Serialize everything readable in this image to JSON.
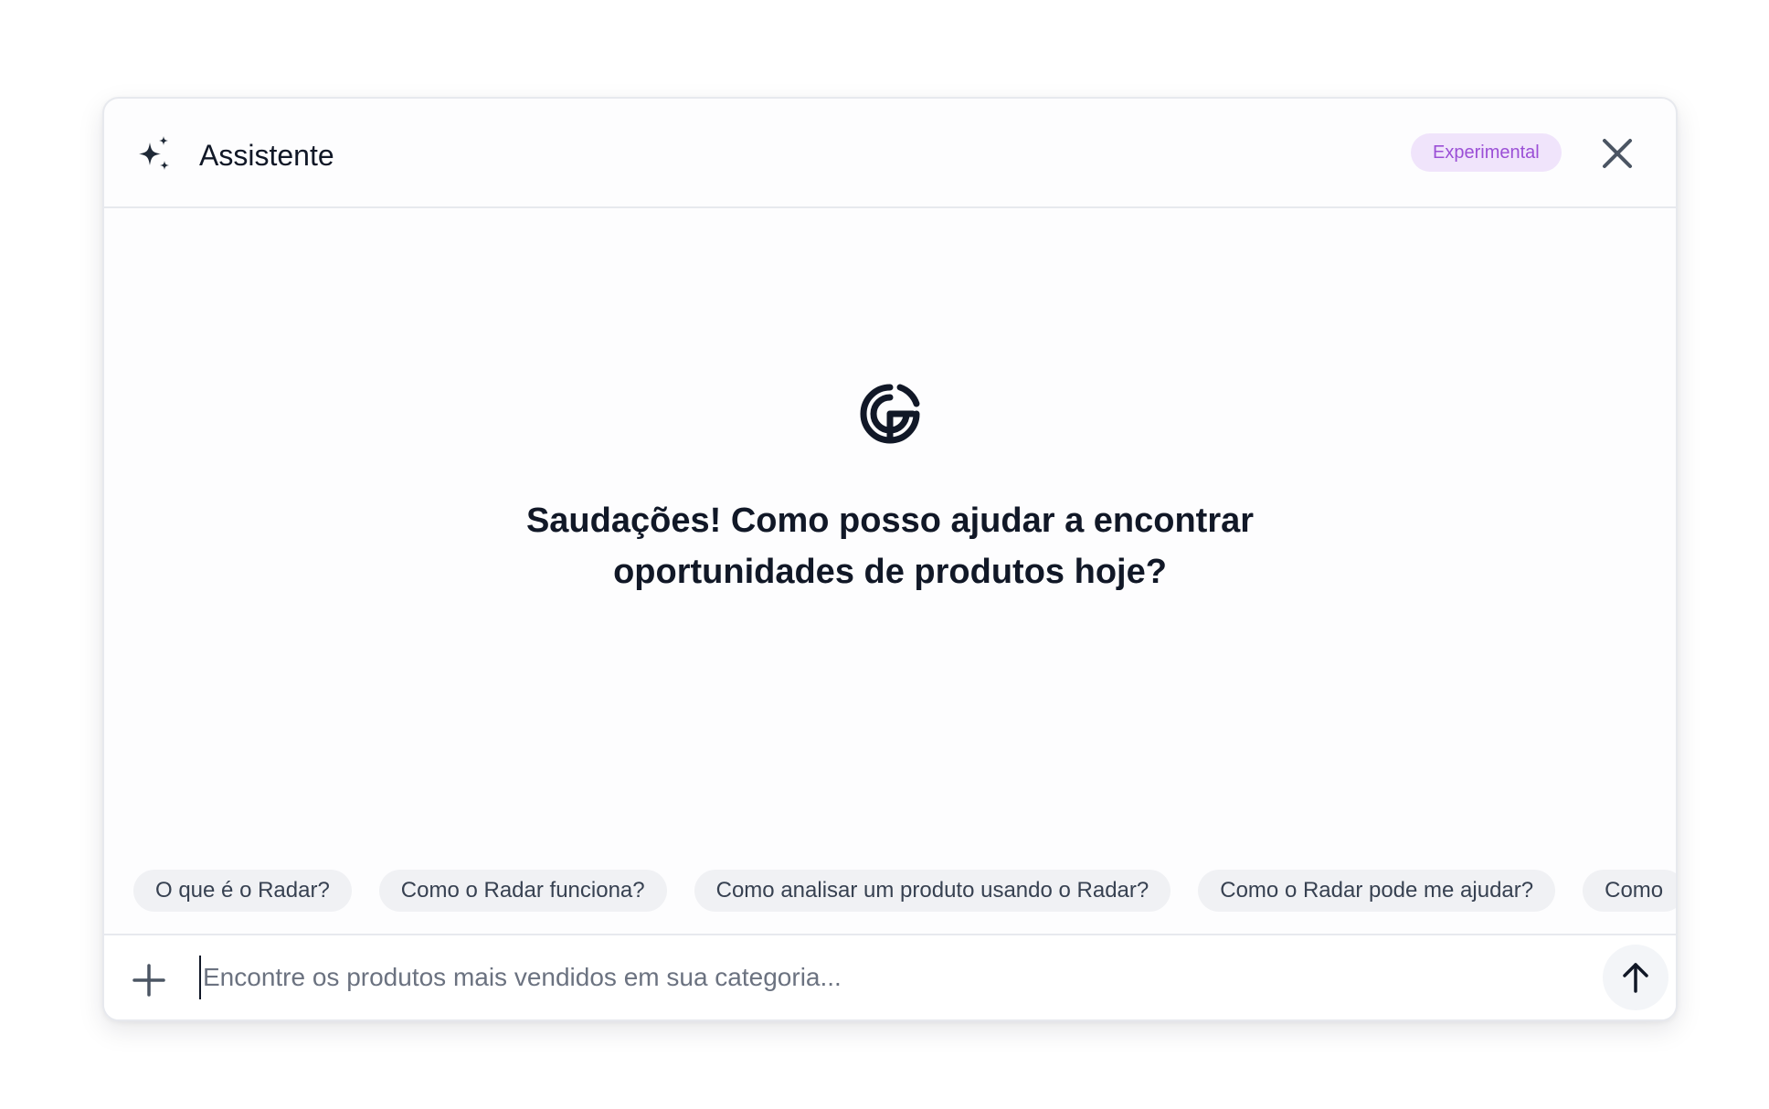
{
  "header": {
    "title": "Assistente",
    "badge": "Experimental",
    "icon": "sparkles-icon",
    "close_icon": "close-icon"
  },
  "hero": {
    "logo_icon": "radar-logo-icon",
    "greeting": "Saudações! Como posso ajudar a encontrar oportunidades de produtos hoje?"
  },
  "suggestions": [
    "O que é o Radar?",
    "Como o Radar funciona?",
    "Como analisar um produto usando o Radar?",
    "Como o Radar pode me ajudar?",
    "Como"
  ],
  "composer": {
    "add_icon": "plus-icon",
    "placeholder": "Encontre os produtos mais vendidos em sua categoria...",
    "value": "",
    "send_icon": "arrow-up-icon"
  },
  "colors": {
    "badge_bg": "#f0e4fb",
    "badge_text": "#9b4fd6",
    "chip_bg": "#f0f1f4",
    "text_primary": "#111827"
  }
}
